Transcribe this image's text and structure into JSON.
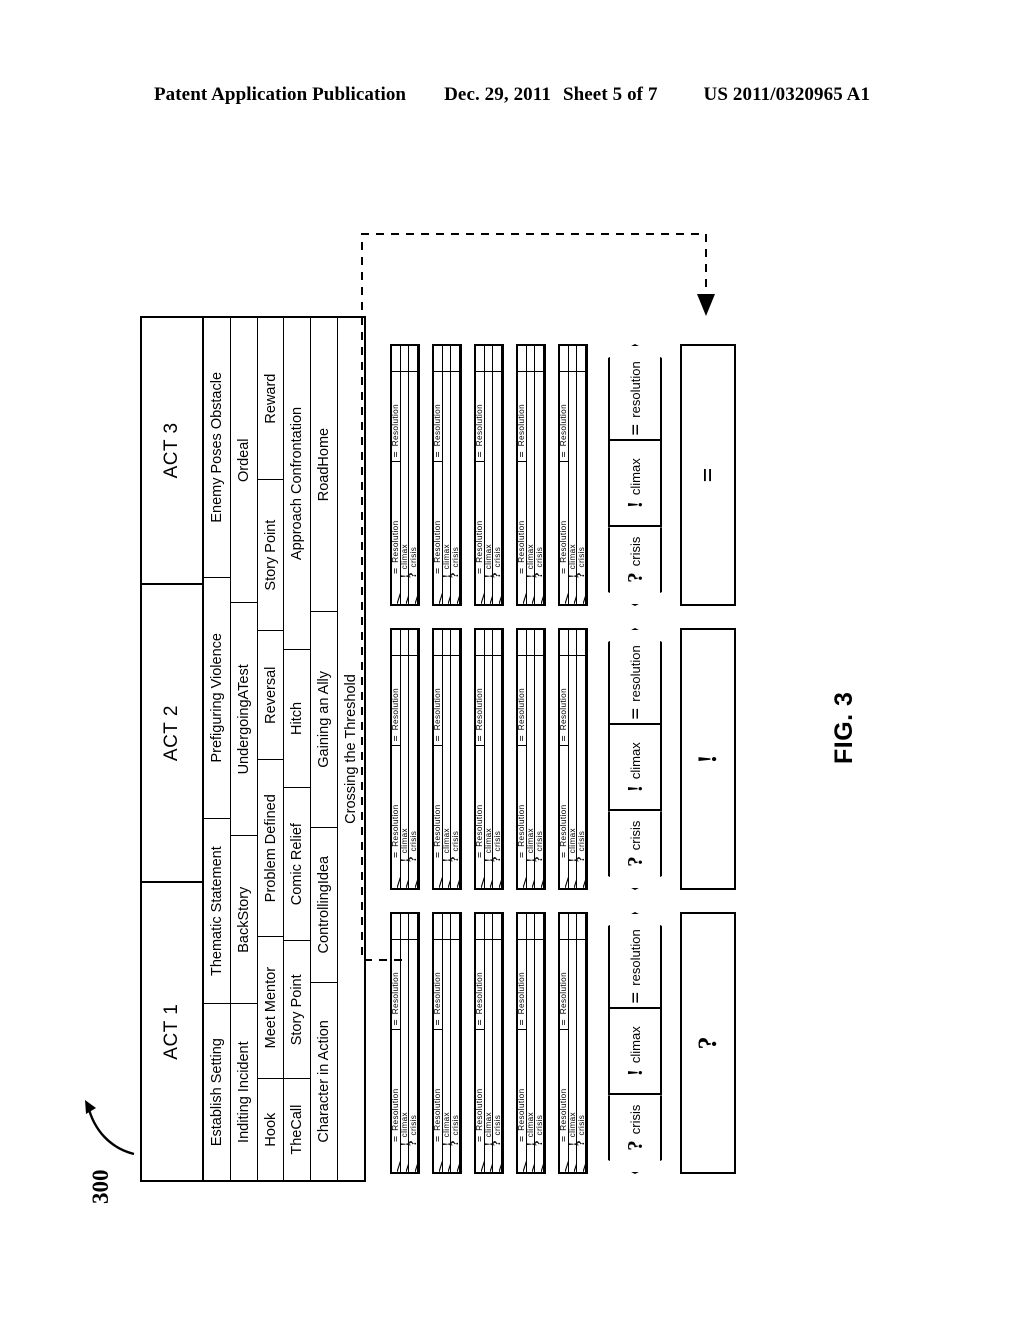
{
  "header": {
    "publication": "Patent Application Publication",
    "date": "Dec. 29, 2011",
    "sheet": "Sheet 5 of 7",
    "number": "US 2011/0320965 A1"
  },
  "figure": {
    "label": "FIG. 3",
    "reference_numeral": "300"
  },
  "act_table": {
    "acts": [
      {
        "label": "ACT 1"
      },
      {
        "label": "ACT 2"
      },
      {
        "label": "ACT 3"
      }
    ],
    "story_point_rows": [
      {
        "cells": [
          "Establish Setting",
          "Thematic Statement",
          "Prefiguring Violence",
          "Enemy Poses Obstacle"
        ]
      },
      {
        "cells": [
          "Inditing Incident",
          "BackStory",
          "UndergoingATest",
          "Ordeal"
        ]
      },
      {
        "cells": [
          "Hook",
          "Meet Mentor",
          "Problem Defined",
          "Reversal",
          "Story Point",
          "Reward"
        ]
      },
      {
        "cells": [
          "TheCall",
          "Story Point",
          "Comic Relief",
          "Hitch",
          "Approach Confrontation"
        ]
      },
      {
        "cells": [
          "Character in Action",
          "ControllingIdea",
          "Gaining an Ally",
          "RoadHome"
        ]
      },
      {
        "cells": [
          "Crossing the Threshold"
        ]
      }
    ]
  },
  "scene_card": {
    "bands": [
      {
        "symbol": "?",
        "text": "crisis"
      },
      {
        "symbol": "!",
        "text": "climax"
      },
      {
        "symbol": "=",
        "text": "Resolution",
        "second_text": "Resolution"
      }
    ]
  },
  "card_groups": [
    {
      "act": "ACT 1",
      "card_count": 5
    },
    {
      "act": "ACT 2",
      "card_count": 5
    },
    {
      "act": "ACT 3",
      "card_count": 5
    }
  ],
  "act_summaries": [
    {
      "act": "ACT 1",
      "segments": [
        {
          "symbol": "?",
          "label": "crisis"
        },
        {
          "symbol": "!",
          "label": "climax"
        },
        {
          "symbol": "=",
          "label": "resolution"
        }
      ]
    },
    {
      "act": "ACT 2",
      "segments": [
        {
          "symbol": "?",
          "label": "crisis"
        },
        {
          "symbol": "!",
          "label": "climax"
        },
        {
          "symbol": "=",
          "label": "resolution"
        }
      ]
    },
    {
      "act": "ACT 3",
      "segments": [
        {
          "symbol": "?",
          "label": "crisis"
        },
        {
          "symbol": "!",
          "label": "climax"
        },
        {
          "symbol": "=",
          "label": "resolution"
        }
      ]
    }
  ],
  "act_bars": [
    {
      "act": "ACT 1",
      "symbol": "?"
    },
    {
      "act": "ACT 2",
      "symbol": "!"
    },
    {
      "act": "ACT 3",
      "symbol": "="
    }
  ],
  "colors": {
    "ink": "#000000",
    "paper": "#ffffff"
  }
}
